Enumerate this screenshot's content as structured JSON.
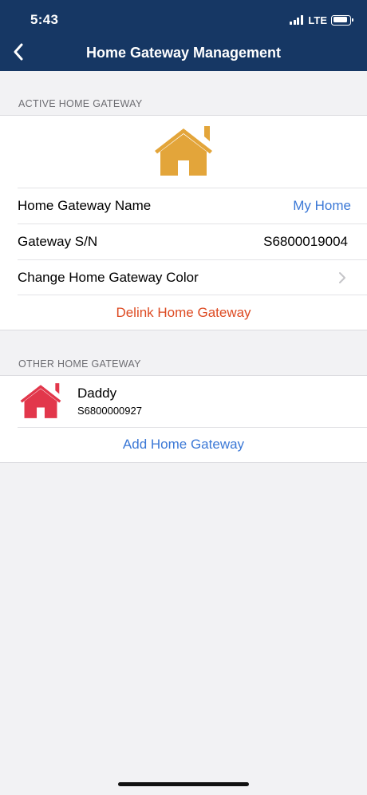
{
  "status_bar": {
    "time": "5:43",
    "network": "LTE"
  },
  "nav": {
    "title": "Home Gateway Management",
    "back_icon": "chevron-left-icon"
  },
  "active_section": {
    "header": "ACTIVE HOME GATEWAY",
    "icon": "house-icon",
    "icon_color": "#e3a53a",
    "rows": [
      {
        "label": "Home Gateway Name",
        "value": "My Home"
      },
      {
        "label": "Gateway S/N",
        "value": "S6800019004"
      },
      {
        "label": "Change Home Gateway Color"
      }
    ],
    "delink_label": "Delink Home Gateway"
  },
  "other_section": {
    "header": "OTHER HOME GATEWAY",
    "gateways": [
      {
        "name": "Daddy",
        "sn": "S6800000927",
        "icon": "house-icon",
        "icon_color": "#e2374b"
      }
    ],
    "add_label": "Add Home Gateway"
  },
  "colors": {
    "header_bg": "#163764",
    "link": "#3b78d6",
    "destructive": "#dd4b23",
    "background": "#f2f2f4"
  }
}
